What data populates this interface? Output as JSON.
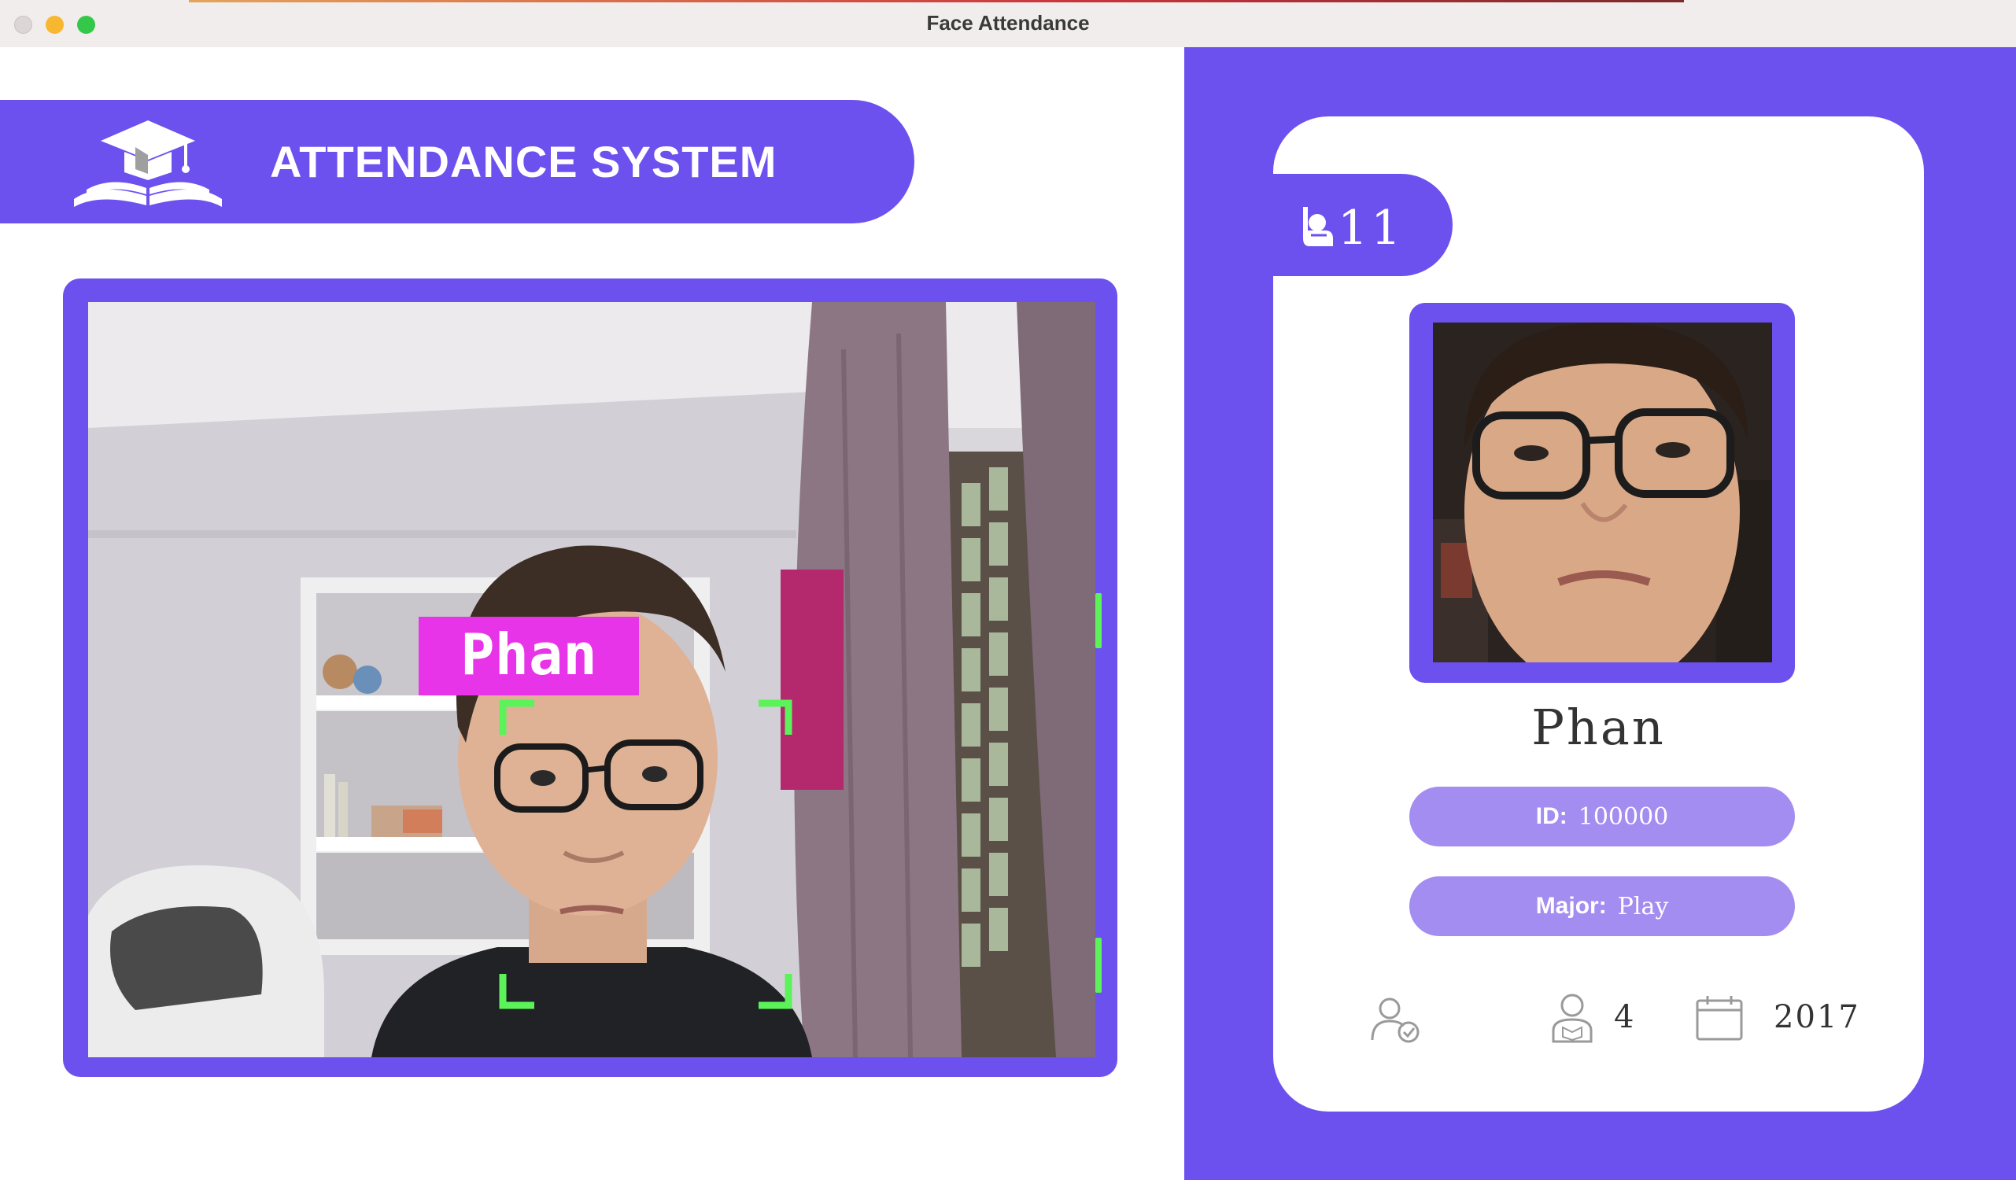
{
  "window": {
    "title": "Face Attendance"
  },
  "header": {
    "title": "ATTENDANCE SYSTEM",
    "logo_icon": "graduation-cap-book-icon"
  },
  "camera": {
    "detected_label": "Phan",
    "label_color": "#e834e8",
    "box_color": "#5bf25a"
  },
  "student": {
    "total_attendance": "11",
    "name": "Phan",
    "id_label": "ID:",
    "id_value": "100000",
    "major_label": "Major:",
    "major_value": "Play",
    "year": "4",
    "starting_year": "2017"
  },
  "icons": {
    "count": "raised-hand-person-icon",
    "attendance": "user-check-icon",
    "year": "student-icon",
    "starting_year": "calendar-icon"
  },
  "colors": {
    "primary": "#6c51ef",
    "pill": "#a48df0",
    "card": "#ffffff"
  }
}
